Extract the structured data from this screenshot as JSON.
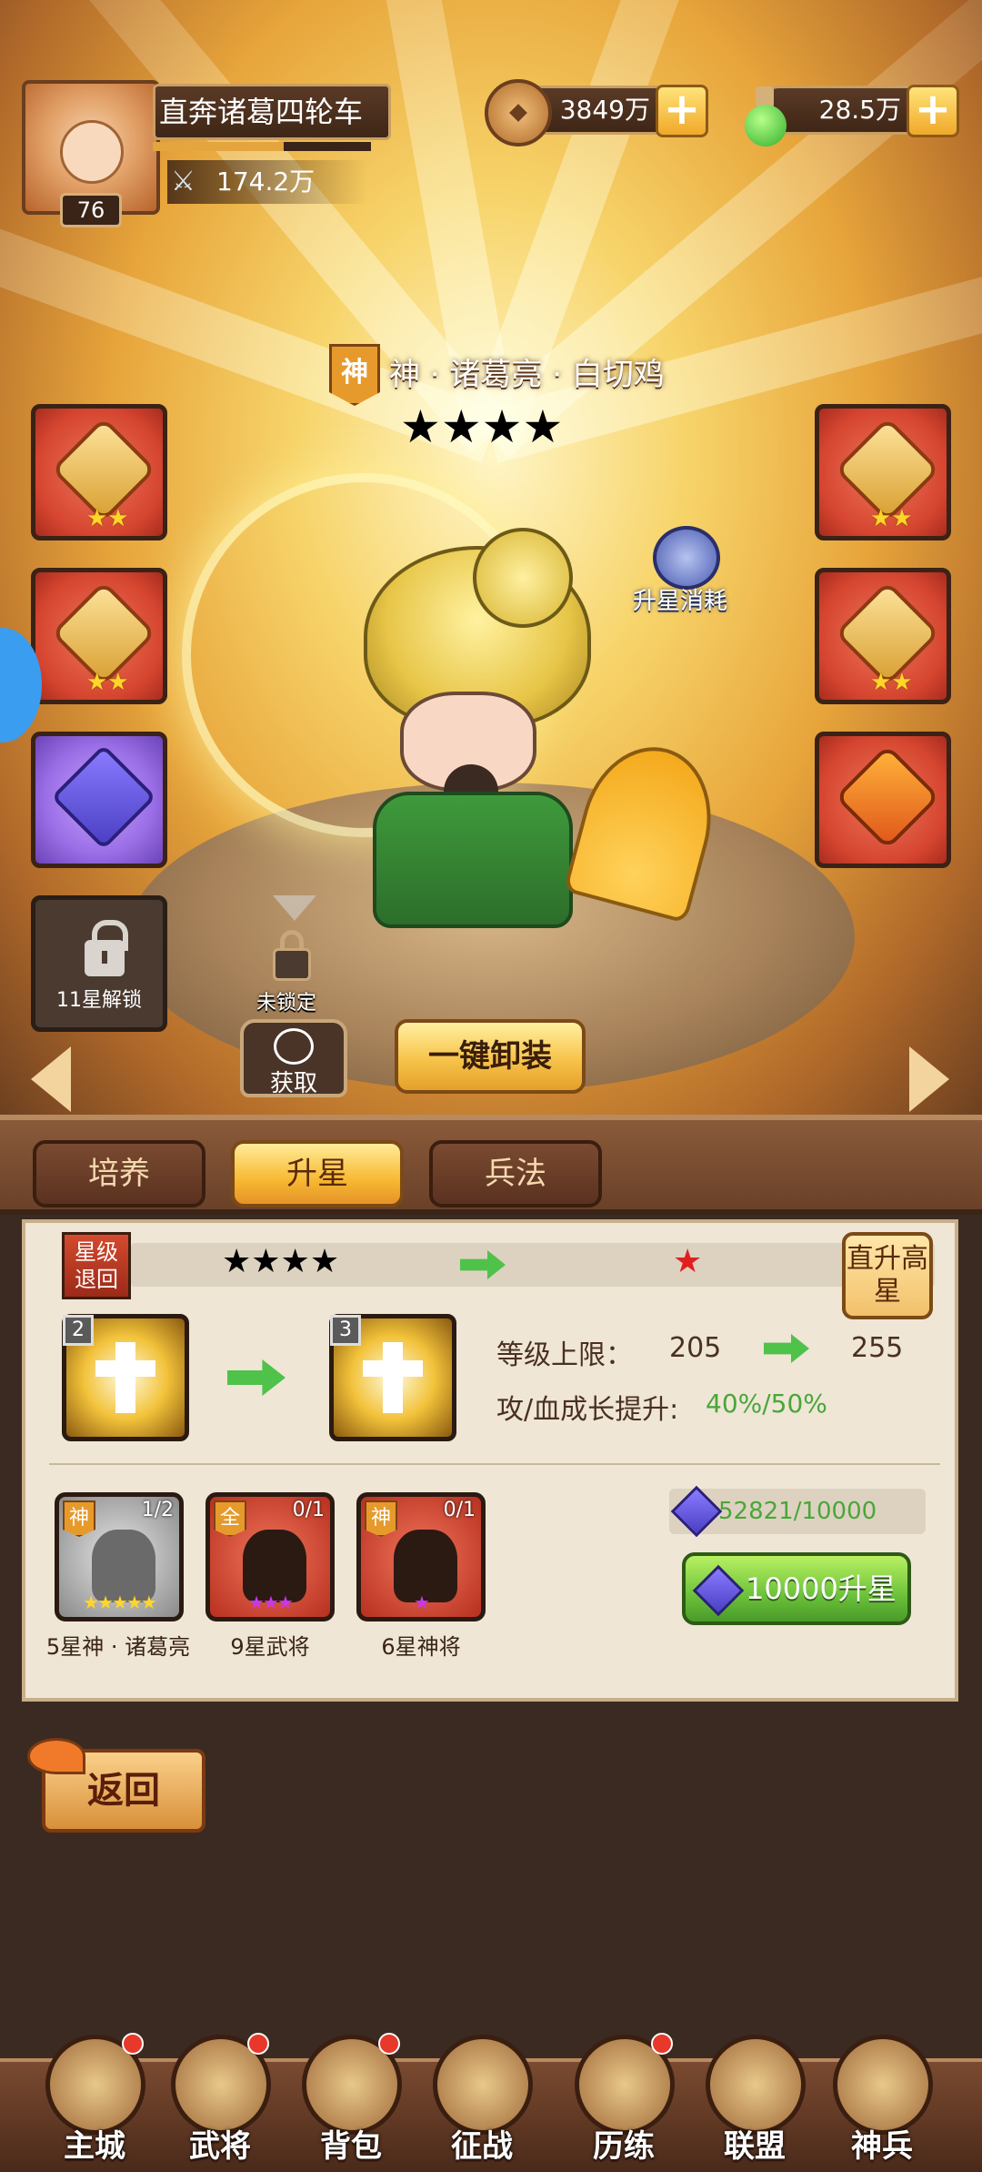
{
  "player": {
    "name": "直奔诸葛四轮车",
    "level": "76",
    "power": "174.2万",
    "exp_fraction": 0.6
  },
  "resources": {
    "copper": "3849万",
    "potion": "28.5万"
  },
  "hero": {
    "badge": "神",
    "name": "神 · 诸葛亮 · 白切鸡",
    "stars": 4,
    "star_glyphs": "★★★★"
  },
  "equip": {
    "locked_slot_label": "11星解锁",
    "slot_stars": "★★"
  },
  "actions": {
    "upgrade_cost_label": "升星消耗",
    "not_locked": "未锁定",
    "obtain": "获取",
    "unequip_all": "一键卸装"
  },
  "tabs": [
    {
      "label": "培养"
    },
    {
      "label": "升星"
    },
    {
      "label": "兵法"
    }
  ],
  "star_panel": {
    "revert_label": "星级退回",
    "direct_label": "直升高星",
    "current_stars": "★★★★",
    "next_stars": "★",
    "skill_from_num": "2",
    "skill_to_num": "3",
    "level_cap_label": "等级上限：",
    "level_cap_from": "205",
    "level_cap_to": "255",
    "growth_label": "攻/血成长提升:",
    "growth_value": "40%/50%",
    "materials": [
      {
        "badge": "神",
        "count": "1/2",
        "stars": "★★★★★",
        "label": "5星神 · 诸葛亮"
      },
      {
        "badge": "全",
        "count": "0/1",
        "stars": "★★★",
        "label": "9星武将"
      },
      {
        "badge": "神",
        "count": "0/1",
        "stars": "★",
        "label": "6星神将"
      }
    ],
    "crystal_amount": "52821/10000",
    "upgrade_button": "10000升星"
  },
  "back_button": "返回",
  "nav": [
    {
      "label": "主城",
      "badge": true
    },
    {
      "label": "武将",
      "badge": true
    },
    {
      "label": "背包",
      "badge": true
    },
    {
      "label": "征战",
      "badge": false
    },
    {
      "label": "历练",
      "badge": true
    },
    {
      "label": "联盟",
      "badge": false
    },
    {
      "label": "神兵",
      "badge": false
    }
  ],
  "colors": {
    "accent_gold": "#f7c34a",
    "accent_green": "#4aa63a",
    "star_purple": "#c838e8",
    "notice_red": "#e8382a"
  }
}
